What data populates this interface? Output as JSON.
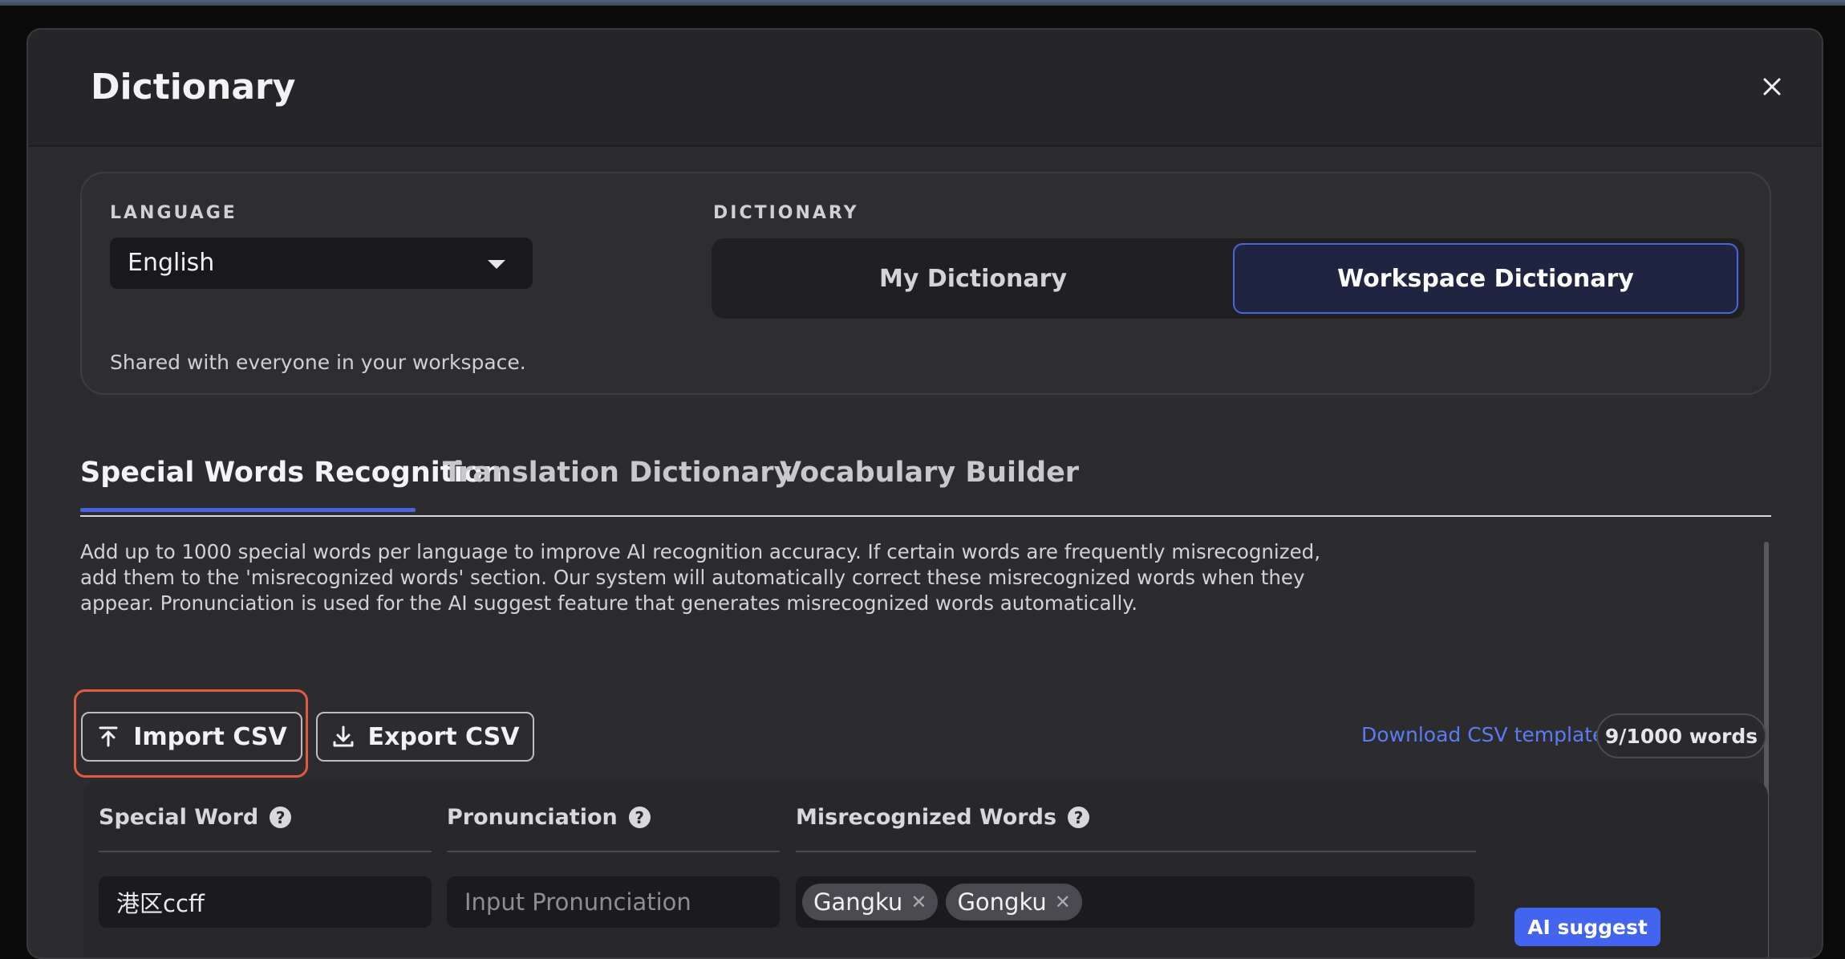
{
  "modal": {
    "title": "Dictionary",
    "close_icon": "close-icon"
  },
  "settings": {
    "language_label": "LANGUAGE",
    "language_value": "English",
    "dictionary_label": "DICTIONARY",
    "dictionary_options": [
      "My Dictionary",
      "Workspace Dictionary"
    ],
    "dictionary_selected": "Workspace Dictionary",
    "shared_note": "Shared with everyone in your workspace."
  },
  "tabs": [
    {
      "label": "Special Words Recognition",
      "active": true
    },
    {
      "label": "Translation Dictionary",
      "active": false
    },
    {
      "label": "Vocabulary Builder",
      "active": false
    }
  ],
  "description": "Add up to 1000 special words per language to improve AI recognition accuracy. If certain words are frequently misrecognized, add them to the 'misrecognized words' section. Our system will automatically correct these misrecognized words when they appear. Pronunciation is used for the AI suggest feature that generates misrecognized words automatically.",
  "actions": {
    "import_label": "Import CSV",
    "export_label": "Export CSV",
    "download_template": "Download CSV template",
    "word_count": "9/1000 words"
  },
  "table": {
    "headers": {
      "special_word": "Special Word",
      "pronunciation": "Pronunciation",
      "misrecognized": "Misrecognized Words"
    },
    "rows": [
      {
        "special_word": "港区ccff",
        "pronunciation_placeholder": "Input Pronunciation",
        "misrecognized": [
          "Gangku",
          "Gongku"
        ],
        "ai_suggest_label": "AI suggest"
      }
    ]
  },
  "colors": {
    "accent": "#4364ef",
    "link": "#5b7cf2",
    "highlight": "#e25a42",
    "background": "#2c2c2f"
  }
}
